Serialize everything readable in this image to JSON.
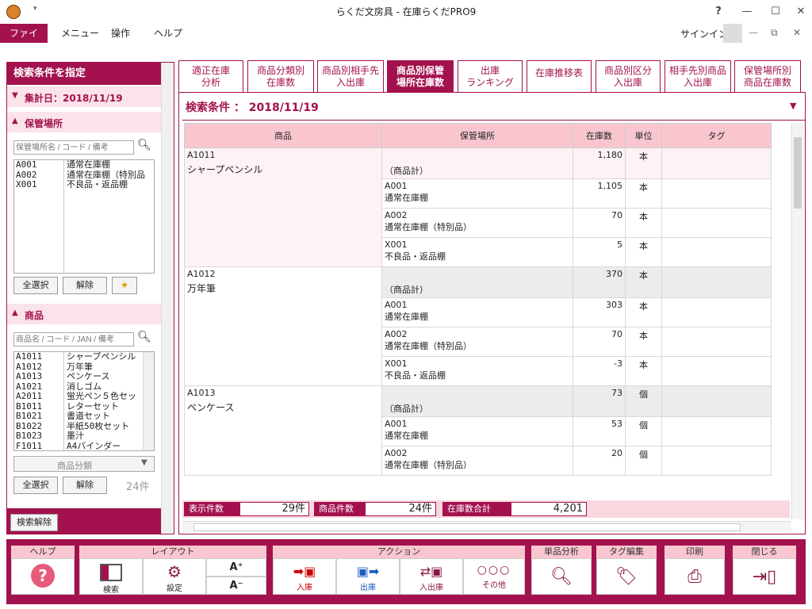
{
  "window": {
    "title": "らくだ文房具 - 在庫らくだPRO9",
    "help_glyph": "?",
    "min_glyph": "—",
    "max_glyph": "☐",
    "close_glyph": "✕"
  },
  "menu": {
    "items": [
      "ファイル",
      "メニュー",
      "操作",
      "ヘルプ"
    ],
    "signin": "サインイン"
  },
  "left": {
    "header": "検索条件を指定",
    "date_label": "集計日：2018/11/19",
    "location_section": "保管場所",
    "location_placeholder": "保管場所名 / コード / 備考",
    "locations": [
      {
        "code": "A001",
        "name": "通常在庫棚"
      },
      {
        "code": "A002",
        "name": "通常在庫棚（特別品"
      },
      {
        "code": "X001",
        "name": "不良品・返品棚"
      }
    ],
    "select_all": "全選択",
    "clear": "解除",
    "product_section": "商品",
    "product_placeholder": "商品名 / コード / JAN / 備考",
    "products": [
      {
        "code": "A1011",
        "name": "シャープペンシル"
      },
      {
        "code": "A1012",
        "name": "万年筆"
      },
      {
        "code": "A1013",
        "name": "ペンケース"
      },
      {
        "code": "A1021",
        "name": "消しゴム"
      },
      {
        "code": "A2011",
        "name": "蛍光ペン５色セッ"
      },
      {
        "code": "B1011",
        "name": "レターセット"
      },
      {
        "code": "B1021",
        "name": "書道セット"
      },
      {
        "code": "B1022",
        "name": "半紙50枚セット"
      },
      {
        "code": "B1023",
        "name": "墨汁"
      },
      {
        "code": "F1011",
        "name": "A4バインダー"
      }
    ],
    "category_placeholder": "商品分類",
    "product_count": "24件",
    "search_clear": "検索解除"
  },
  "tabs": [
    {
      "line1": "適正在庫",
      "line2": "分析"
    },
    {
      "line1": "商品分類別",
      "line2": "在庫数"
    },
    {
      "line1": "商品別相手先",
      "line2": "入出庫"
    },
    {
      "line1": "商品別保管",
      "line2": "場所在庫数"
    },
    {
      "line1": "出庫",
      "line2": "ランキング"
    },
    {
      "line1": "在庫推移表",
      "line2": ""
    },
    {
      "line1": "商品別区分",
      "line2": "入出庫"
    },
    {
      "line1": "相手先別商品",
      "line2": "入出庫"
    },
    {
      "line1": "保管場所別",
      "line2": "商品在庫数"
    }
  ],
  "main": {
    "condition": "検索条件 ： 2018/11/19",
    "columns": [
      "商品",
      "保管場所",
      "在庫数",
      "単位",
      "タグ"
    ],
    "groups": [
      {
        "code": "A1011",
        "name": "シャープペンシル",
        "rows": [
          {
            "loc_code": "",
            "loc_name": "（商品計）",
            "qty": "1,180",
            "unit": "本"
          },
          {
            "loc_code": "A001",
            "loc_name": "通常在庫棚",
            "qty": "1,105",
            "unit": "本"
          },
          {
            "loc_code": "A002",
            "loc_name": "通常在庫棚（特別品）",
            "qty": "70",
            "unit": "本"
          },
          {
            "loc_code": "X001",
            "loc_name": "不良品・返品棚",
            "qty": "5",
            "unit": "本"
          }
        ]
      },
      {
        "code": "A1012",
        "name": "万年筆",
        "rows": [
          {
            "loc_code": "",
            "loc_name": "（商品計）",
            "qty": "370",
            "unit": "本"
          },
          {
            "loc_code": "A001",
            "loc_name": "通常在庫棚",
            "qty": "303",
            "unit": "本"
          },
          {
            "loc_code": "A002",
            "loc_name": "通常在庫棚（特別品）",
            "qty": "70",
            "unit": "本"
          },
          {
            "loc_code": "X001",
            "loc_name": "不良品・返品棚",
            "qty": "-3",
            "unit": "本"
          }
        ]
      },
      {
        "code": "A1013",
        "name": "ペンケース",
        "rows": [
          {
            "loc_code": "",
            "loc_name": "（商品計）",
            "qty": "73",
            "unit": "個"
          },
          {
            "loc_code": "A001",
            "loc_name": "通常在庫棚",
            "qty": "53",
            "unit": "個"
          },
          {
            "loc_code": "A002",
            "loc_name": "通常在庫棚（特別品）",
            "qty": "20",
            "unit": "個"
          }
        ]
      }
    ],
    "status": {
      "display_label": "表示件数",
      "display_value": "29件",
      "product_label": "商品件数",
      "product_value": "24件",
      "total_label": "在庫数合計",
      "total_value": "4,201"
    }
  },
  "toolbar": {
    "help": "ヘルプ",
    "layout": "レイアウト",
    "search": "検索",
    "settings": "設定",
    "font_up": "A⁺",
    "font_down": "A⁻",
    "action": "アクション",
    "in": "入庫",
    "out": "出庫",
    "inout": "入出庫",
    "other": "その他",
    "analysis": "単品分析",
    "tag": "タグ編集",
    "print": "印刷",
    "close": "閉じる"
  },
  "colors": {
    "accent": "#a3124e",
    "header_pink": "#f9c6d0"
  }
}
